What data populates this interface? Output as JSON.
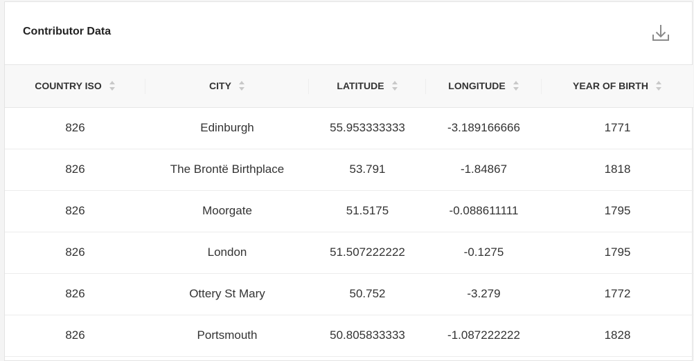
{
  "card": {
    "title": "Contributor Data",
    "download_icon": "download-icon"
  },
  "table": {
    "columns": [
      {
        "label": "COUNTRY ISO"
      },
      {
        "label": "CITY"
      },
      {
        "label": "LATITUDE"
      },
      {
        "label": "LONGITUDE"
      },
      {
        "label": "YEAR OF BIRTH"
      }
    ],
    "rows": [
      {
        "iso": "826",
        "city": "Edinburgh",
        "lat": "55.953333333",
        "lon": "-3.189166666",
        "year": "1771"
      },
      {
        "iso": "826",
        "city": "The Brontë Birthplace",
        "lat": "53.791",
        "lon": "-1.84867",
        "year": "1818"
      },
      {
        "iso": "826",
        "city": "Moorgate",
        "lat": "51.5175",
        "lon": "-0.088611111",
        "year": "1795"
      },
      {
        "iso": "826",
        "city": "London",
        "lat": "51.507222222",
        "lon": "-0.1275",
        "year": "1795"
      },
      {
        "iso": "826",
        "city": "Ottery St Mary",
        "lat": "50.752",
        "lon": "-3.279",
        "year": "1772"
      },
      {
        "iso": "826",
        "city": "Portsmouth",
        "lat": "50.805833333",
        "lon": "-1.087222222",
        "year": "1828"
      }
    ]
  },
  "colors": {
    "header_bg": "#f8f8f8",
    "border": "#e6e6e6",
    "text": "#333333",
    "icon": "#8a8a8a"
  }
}
